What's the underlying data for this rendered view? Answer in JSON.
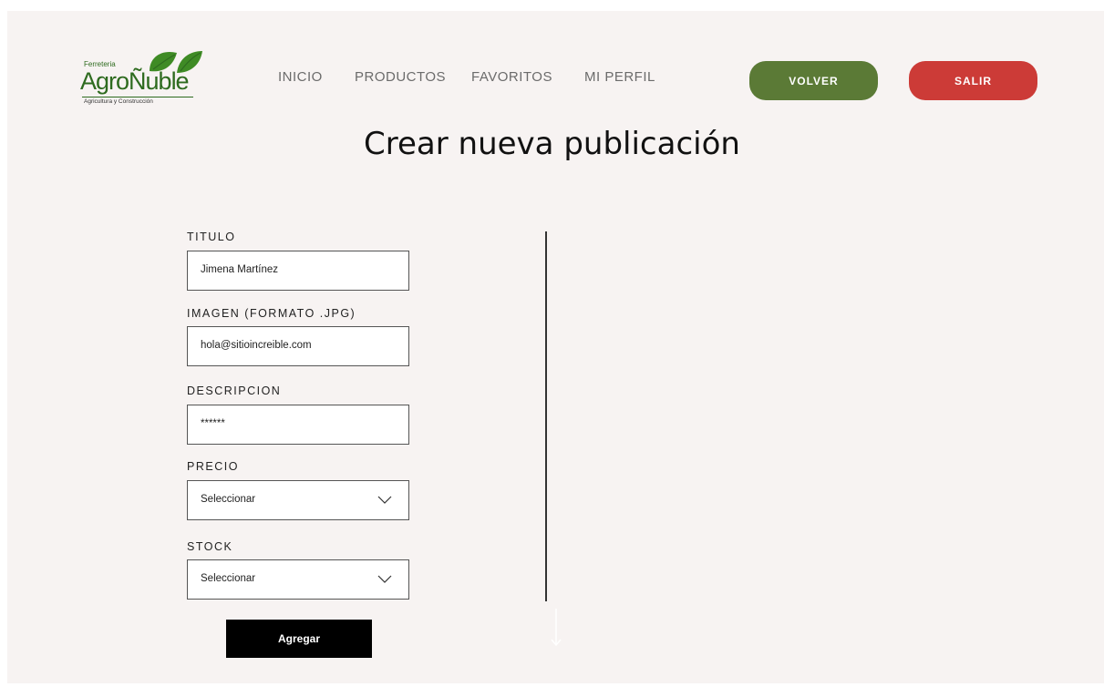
{
  "logo": {
    "top_text": "Ferreteria",
    "main_text": "AgroÑuble",
    "sub_text": "Agricultura y Construcción"
  },
  "nav": {
    "items": [
      {
        "label": "INICIO"
      },
      {
        "label": "PRODUCTOS"
      },
      {
        "label": "FAVORITOS"
      },
      {
        "label": "MI PERFIL"
      }
    ]
  },
  "header": {
    "back_label": "VOLVER",
    "logout_label": "SALIR"
  },
  "main": {
    "title": "Crear nueva publicación"
  },
  "form": {
    "titulo": {
      "label": "TITULO",
      "value": "Jimena Martínez"
    },
    "imagen": {
      "label": "IMAGEN (FORMATO .JPG)",
      "value": "hola@sitioincreible.com"
    },
    "descripcion": {
      "label": "DESCRIPCION",
      "value": "******"
    },
    "precio": {
      "label": "PRECIO",
      "value": "Seleccionar"
    },
    "stock": {
      "label": "STOCK",
      "value": "Seleccionar"
    },
    "submit_label": "Agregar"
  },
  "colors": {
    "page_bg": "#f7f3f2",
    "brand_green": "#2e6b1f",
    "volver_bg": "#5b7a36",
    "salir_bg": "#cc3b37",
    "agregar_bg": "#000000"
  },
  "icons": [
    "leaves-logo-icon",
    "chevron-down-icon",
    "arrow-down-icon"
  ]
}
